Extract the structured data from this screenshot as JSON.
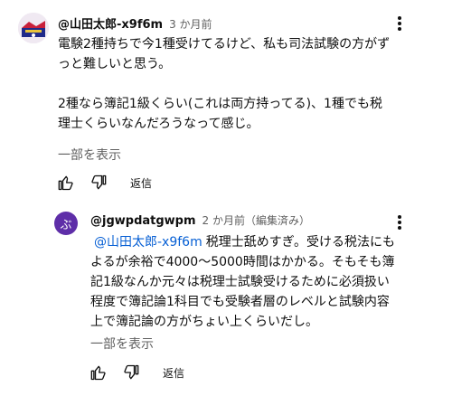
{
  "comment": {
    "author": "@山田太郎-x9f6m",
    "time": "3 か月前",
    "lines": [
      "電験2種持ちで今1種受けてるけど、私も司法試験の方がず",
      "っと難しいと思う。",
      "",
      "2種なら簿記1級くらい(これは両方持ってる)、1種でも税",
      "理士くらいなんだろうなって感じ。"
    ],
    "more_label": "一部を表示",
    "reply_label": "返信",
    "icons": {
      "avatar": "user-avatar-image",
      "menu": "more-vert-icon",
      "like": "thumb-up-icon",
      "dislike": "thumb-down-icon"
    }
  },
  "reply_comment": {
    "avatar_letter": "ぶ",
    "avatar_color": "#5e2ea8",
    "author": "@jgwpdatgwpm",
    "time": "2 か月前（編集済み）",
    "mention": "@山田太郎-x9f6m",
    "lines": [
      "税理士舐めすぎ。受ける税法にも",
      "よるが余裕で4000〜5000時間はかかる。そもそも簿",
      "記1級なんか元々は税理士試験受けるために必須扱い",
      "程度で簿記論1科目でも受験者層のレベルと試験内容",
      "上で簿記論の方がちょい上くらいだし。"
    ],
    "more_label": "一部を表示",
    "reply_label": "返信",
    "icons": {
      "menu": "more-vert-icon",
      "like": "thumb-up-icon",
      "dislike": "thumb-down-icon"
    }
  },
  "colors": {
    "link": "#065fd4",
    "secondary_text": "#606060",
    "text": "#0f0f0f"
  }
}
